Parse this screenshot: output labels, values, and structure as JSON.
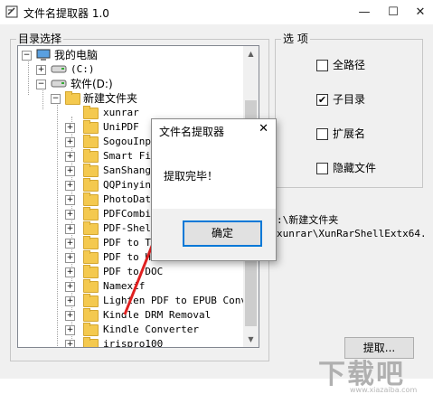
{
  "window": {
    "title": "文件名提取器 1.0",
    "minimize_glyph": "—",
    "maximize_glyph": "☐",
    "close_glyph": "✕"
  },
  "directory": {
    "label": "目录选择",
    "tree": [
      {
        "label": "我的电脑",
        "icon": "computer-icon",
        "expander": "−"
      },
      {
        "label": "(C:)",
        "icon": "drive-icon",
        "expander": "+"
      },
      {
        "label": "软件(D:)",
        "icon": "drive-icon",
        "expander": "−"
      },
      {
        "label": "新建文件夹",
        "icon": "folder-icon",
        "expander": "−"
      },
      {
        "label": "xunrar",
        "icon": "folder-icon",
        "expander": ""
      },
      {
        "label": "UniPDF",
        "icon": "folder-icon",
        "expander": "+"
      },
      {
        "label": "SogouInpu",
        "icon": "folder-icon",
        "expander": "+"
      },
      {
        "label": "Smart Fil",
        "icon": "folder-icon",
        "expander": "+"
      },
      {
        "label": "SanShangW",
        "icon": "folder-icon",
        "expander": "+"
      },
      {
        "label": "QQPinyin",
        "icon": "folder-icon",
        "expander": "+"
      },
      {
        "label": "PhotoDate",
        "icon": "folder-icon",
        "expander": "+"
      },
      {
        "label": "PDFCombin",
        "icon": "folder-icon",
        "expander": "+"
      },
      {
        "label": "PDF-Shell",
        "icon": "folder-icon",
        "expander": "+"
      },
      {
        "label": "PDF to T",
        "icon": "folder-icon",
        "expander": "+"
      },
      {
        "label": "PDF to HTML",
        "icon": "folder-icon",
        "expander": "+"
      },
      {
        "label": "PDF to DOC",
        "icon": "folder-icon",
        "expander": "+"
      },
      {
        "label": "Namexif",
        "icon": "folder-icon",
        "expander": "+"
      },
      {
        "label": "Lighten PDF to EPUB Conve",
        "icon": "folder-icon",
        "expander": "+"
      },
      {
        "label": "Kindle DRM Removal",
        "icon": "folder-icon",
        "expander": "+"
      },
      {
        "label": "Kindle Converter",
        "icon": "folder-icon",
        "expander": "+"
      },
      {
        "label": "irispro100",
        "icon": "folder-icon",
        "expander": "+"
      }
    ]
  },
  "options": {
    "label": "选 项",
    "items": [
      {
        "label": "全路径",
        "checked": false
      },
      {
        "label": "子目录",
        "checked": true
      },
      {
        "label": "扩展名",
        "checked": false
      },
      {
        "label": "隐藏文件",
        "checked": false
      }
    ]
  },
  "result": {
    "line1": ":\\新建文件夹",
    "line2": "xunrar\\XunRarShellExtx64."
  },
  "extract_button": "提取...",
  "dialog": {
    "title": "文件名提取器",
    "close_glyph": "✕",
    "message": "提取完毕！",
    "ok_label": "确定"
  },
  "watermark": {
    "text": "下载吧",
    "url": "www.xiazaiba.com"
  },
  "colors": {
    "accent_arrow": "#e02020",
    "dialog_button_border": "#0078d7",
    "folder": "#f4c94f"
  }
}
